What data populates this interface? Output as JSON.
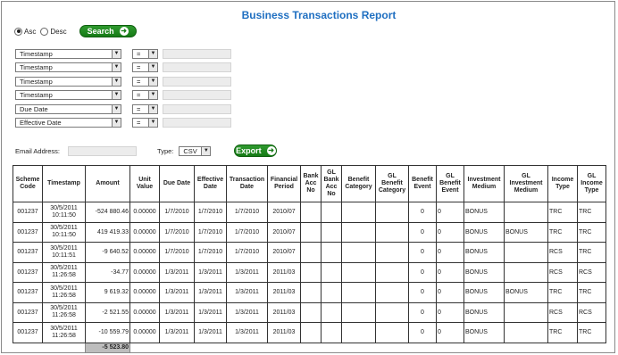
{
  "title": "Business Transactions Report",
  "sort": {
    "asc_label": "Asc",
    "desc_label": "Desc",
    "selected": "Asc"
  },
  "search_label": "Search",
  "filters": [
    {
      "field": "Timestamp",
      "op": "=",
      "value": ""
    },
    {
      "field": "Timestamp",
      "op": "=",
      "value": ""
    },
    {
      "field": "Timestamp",
      "op": "=",
      "value": ""
    },
    {
      "field": "Timestamp",
      "op": "=",
      "value": ""
    },
    {
      "field": "Due Date",
      "op": "=",
      "value": ""
    },
    {
      "field": "Effective Date",
      "op": "=",
      "value": ""
    }
  ],
  "email_label": "Email Address:",
  "email_value": "",
  "type_label": "Type:",
  "type_value": "CSV",
  "export_label": "Export",
  "table": {
    "headers": [
      "Scheme Code",
      "Timestamp",
      "Amount",
      "Unit Value",
      "Due Date",
      "Effective Date",
      "Transaction Date",
      "Financial Period",
      "Bank Acc No",
      "GL Bank Acc No",
      "Benefit Category",
      "GL Benefit Category",
      "Benefit Event",
      "GL Benefit Event",
      "Investment Medium",
      "GL Investment Medium",
      "Income Type",
      "GL Income Type"
    ],
    "rows": [
      [
        "001237",
        "30/5/2011 10:11:50",
        "-524 880.46",
        "0.00000",
        "1/7/2010",
        "1/7/2010",
        "1/7/2010",
        "2010/07",
        "",
        "",
        "",
        "",
        "0",
        "0",
        "BONUS",
        "",
        "TRC",
        "TRC"
      ],
      [
        "001237",
        "30/5/2011 10:11:50",
        "419 419.33",
        "0.00000",
        "1/7/2010",
        "1/7/2010",
        "1/7/2010",
        "2010/07",
        "",
        "",
        "",
        "",
        "0",
        "0",
        "BONUS",
        "BONUS",
        "TRC",
        "TRC"
      ],
      [
        "001237",
        "30/5/2011 10:11:51",
        "-9 640.52",
        "0.00000",
        "1/7/2010",
        "1/7/2010",
        "1/7/2010",
        "2010/07",
        "",
        "",
        "",
        "",
        "0",
        "0",
        "BONUS",
        "",
        "RCS",
        "TRC"
      ],
      [
        "001237",
        "30/5/2011 11:26:58",
        "-34.77",
        "0.00000",
        "1/3/2011",
        "1/3/2011",
        "1/3/2011",
        "2011/03",
        "",
        "",
        "",
        "",
        "0",
        "0",
        "BONUS",
        "",
        "RCS",
        "RCS"
      ],
      [
        "001237",
        "30/5/2011 11:26:58",
        "9 619.32",
        "0.00000",
        "1/3/2011",
        "1/3/2011",
        "1/3/2011",
        "2011/03",
        "",
        "",
        "",
        "",
        "0",
        "0",
        "BONUS",
        "BONUS",
        "TRC",
        "TRC"
      ],
      [
        "001237",
        "30/5/2011 11:26:58",
        "-2 521.55",
        "0.00000",
        "1/3/2011",
        "1/3/2011",
        "1/3/2011",
        "2011/03",
        "",
        "",
        "",
        "",
        "0",
        "0",
        "BONUS",
        "",
        "RCS",
        "RCS"
      ],
      [
        "001237",
        "30/5/2011 11:26:58",
        "-10 559.79",
        "0.00000",
        "1/3/2011",
        "1/3/2011",
        "1/3/2011",
        "2011/03",
        "",
        "",
        "",
        "",
        "0",
        "0",
        "BONUS",
        "",
        "TRC",
        "TRC"
      ]
    ],
    "total": "-5 523.80"
  }
}
